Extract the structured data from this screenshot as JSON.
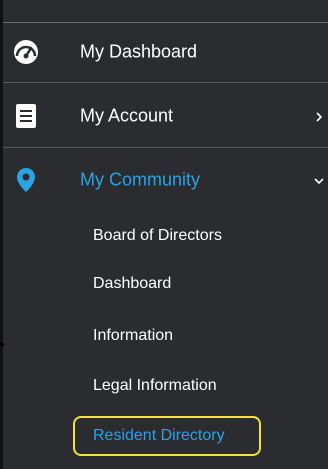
{
  "menu": {
    "items": [
      {
        "label": "My Dashboard",
        "icon": "dashboard-gauge-icon"
      },
      {
        "label": "My Account",
        "icon": "account-document-icon",
        "chevron": "chevron-right-icon"
      },
      {
        "label": "My Community",
        "icon": "location-pin-icon",
        "chevron": "chevron-down-icon",
        "active": true
      }
    ],
    "subitems": [
      {
        "label": "Board of Directors"
      },
      {
        "label": "Dashboard"
      },
      {
        "label": "Information"
      },
      {
        "label": "Legal Information"
      },
      {
        "label": "Resident Directory",
        "selected": true
      }
    ]
  },
  "colors": {
    "sidebar_bg": "#2b2c2f",
    "accent_blue": "#2aa3e4",
    "highlight_yellow": "#f2e13a",
    "text": "#ffffff"
  }
}
